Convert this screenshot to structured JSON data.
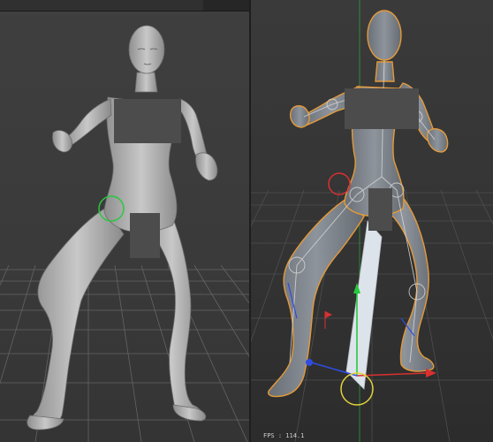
{
  "viewport_right": {
    "fps_label": "FPS : 114.1"
  },
  "colors": {
    "body": "#b9b9b9",
    "censor": "#4c4c4c",
    "selection_outline": "#e39a3a",
    "axis_x": "#d93030",
    "axis_y": "#27c83e",
    "axis_z": "#2f4de0",
    "joint_circle": "#e3d23a"
  }
}
